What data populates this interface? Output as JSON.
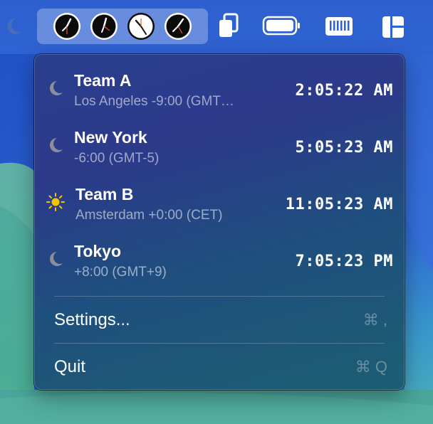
{
  "menubar": {
    "icons": [
      "moon-icon",
      "clock-icon",
      "clipboard-icon",
      "battery-icon",
      "memory-icon",
      "window-layout-icon"
    ]
  },
  "timezones": [
    {
      "name": "Team A",
      "detail": "Los Angeles -9:00 (GMT…",
      "time": "2:05:22 AM",
      "icon": "moon-icon"
    },
    {
      "name": "New York",
      "detail": "-6:00 (GMT-5)",
      "time": "5:05:23 AM",
      "icon": "moon-icon"
    },
    {
      "name": "Team B",
      "detail": "Amsterdam +0:00 (CET)",
      "time": "11:05:23 AM",
      "icon": "sun-icon"
    },
    {
      "name": "Tokyo",
      "detail": "+8:00 (GMT+9)",
      "time": "7:05:23 PM",
      "icon": "moon-icon"
    }
  ],
  "menu": {
    "settings_label": "Settings...",
    "settings_shortcut": "⌘ ,",
    "quit_label": "Quit",
    "quit_shortcut": "⌘ Q"
  },
  "colors": {
    "menubar": "#2f63d2",
    "sun": "#f5c400",
    "moon": "#8e8e9a"
  }
}
